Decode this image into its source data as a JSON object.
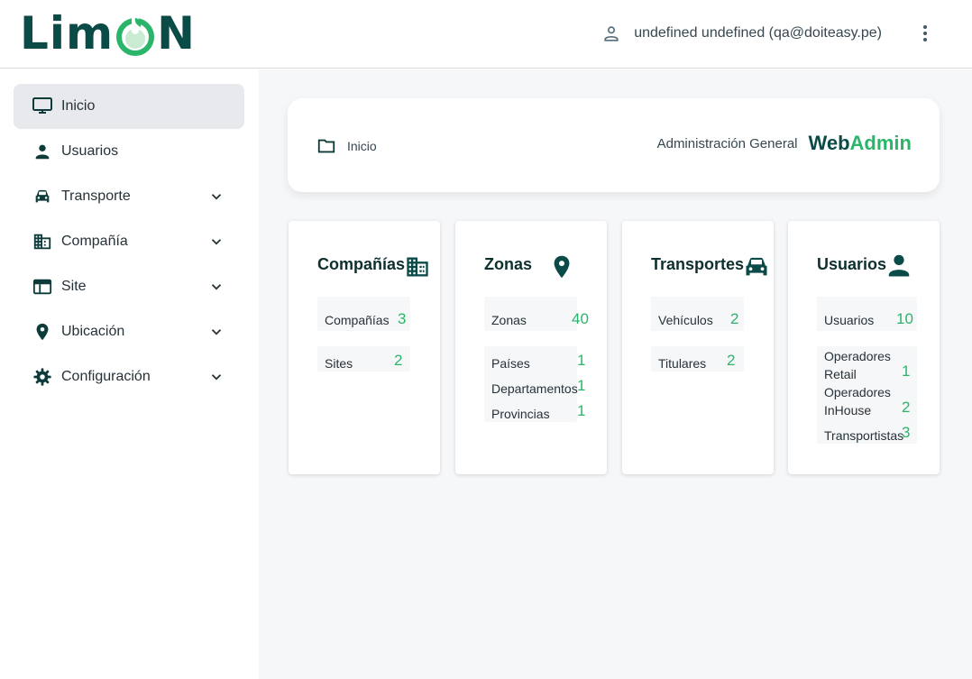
{
  "header": {
    "logo_text": "LimON",
    "user_label": "undefined undefined (qa@doiteasy.pe)"
  },
  "sidebar": {
    "items": [
      {
        "label": "Inicio",
        "icon": "monitor-icon",
        "active": true
      },
      {
        "label": "Usuarios",
        "icon": "person-icon"
      },
      {
        "label": "Transporte",
        "icon": "car-icon",
        "expandable": true
      },
      {
        "label": "Compañía",
        "icon": "building-icon",
        "expandable": true
      },
      {
        "label": "Site",
        "icon": "browser-window-icon",
        "expandable": true
      },
      {
        "label": "Ubicación",
        "icon": "location-pin-icon",
        "expandable": true
      },
      {
        "label": "Configuración",
        "icon": "gear-icon",
        "expandable": true
      }
    ]
  },
  "breadcrumb": {
    "current": "Inicio",
    "section": "Administración General",
    "brand_web": "Web",
    "brand_admin": "Admin"
  },
  "cards": {
    "companias": {
      "title": "Compañías",
      "rows": [
        {
          "label": "Compañías",
          "value": "3"
        },
        {
          "label": "Sites",
          "value": "2"
        }
      ]
    },
    "zonas": {
      "title": "Zonas",
      "rows": [
        {
          "label": "Zonas",
          "value": "40"
        },
        {
          "label": "Países",
          "value": "1"
        },
        {
          "label": "Departamentos",
          "value": "1"
        },
        {
          "label": "Provincias",
          "value": "1"
        }
      ]
    },
    "transportes": {
      "title": "Transportes",
      "rows": [
        {
          "label": "Vehículos",
          "value": "2"
        },
        {
          "label": "Titulares",
          "value": "2"
        }
      ]
    },
    "usuarios": {
      "title": "Usuarios",
      "rows": [
        {
          "label": "Usuarios",
          "value": "10"
        },
        {
          "label_line1": "Operadores",
          "label_line2": "Retail",
          "value": "1"
        },
        {
          "label_line1": "Operadores",
          "label_line2": "InHouse",
          "value": "2"
        },
        {
          "label": "Transportistas",
          "value": "3"
        }
      ]
    }
  },
  "colors": {
    "brand_dark": "#0a4a47",
    "brand_green": "#2bb56a",
    "active_bg": "#e8e9ec",
    "main_bg": "#f6f7f9"
  }
}
